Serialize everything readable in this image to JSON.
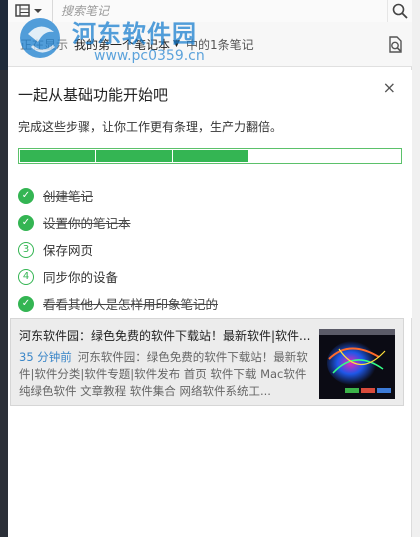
{
  "search": {
    "placeholder": "搜索笔记"
  },
  "filter": {
    "prefix": "正在显示",
    "notebook": "我的第一个笔记本",
    "suffix": "中的1条笔记"
  },
  "watermark": {
    "title": "河东软件园",
    "url": "www.pc0359.cn"
  },
  "getting_started": {
    "title": "一起从基础功能开始吧",
    "close_label": "×",
    "description": "完成这些步骤，让你工作更有条理，生产力翻倍。",
    "progress": {
      "completed": 3,
      "total": 5
    },
    "steps": [
      {
        "label": "创建笔记",
        "done": true,
        "number": ""
      },
      {
        "label": "设置你的笔记本",
        "done": true,
        "number": ""
      },
      {
        "label": "保存网页",
        "done": false,
        "number": "3"
      },
      {
        "label": "同步你的设备",
        "done": false,
        "number": "4"
      },
      {
        "label": "看看其他人是怎样用印象笔记的",
        "done": true,
        "number": ""
      }
    ]
  },
  "note": {
    "title": "河东软件园：绿色免费的软件下载站！最新软件|软件...",
    "time": "35 分钟前",
    "snippet": "河东软件园：绿色免费的软件下载站！最新软件|软件分类|软件专题|软件发布 首页 软件下载 Mac软件 纯绿色软件 文章教程 软件集合 网络软件系统工..."
  },
  "colors": {
    "accent_green": "#34b553",
    "link_blue": "#3a86c8"
  }
}
